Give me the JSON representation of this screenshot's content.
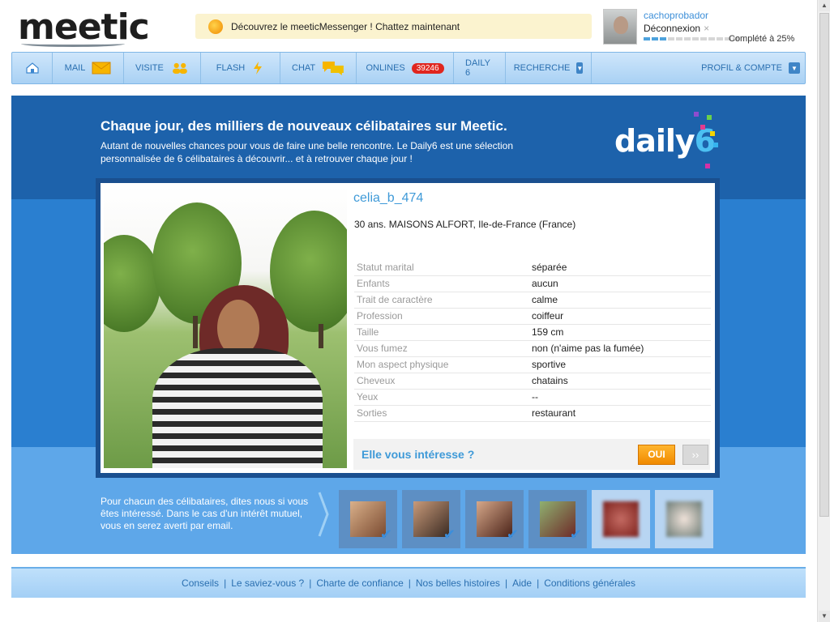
{
  "header": {
    "logo": "meetic",
    "promo_text": "Découvrez le meeticMessenger ! Chattez maintenant",
    "user": {
      "name": "cachoprobador",
      "logout": "Déconnexion",
      "completion": "Complété à 25%",
      "completion_value": 0.25
    }
  },
  "nav": {
    "items": [
      {
        "label": "",
        "icon": "home-icon"
      },
      {
        "label": "MAIL",
        "icon": "envelope-icon"
      },
      {
        "label": "VISITE",
        "icon": "people-icon"
      },
      {
        "label": "FLASH",
        "icon": "lightning-icon"
      },
      {
        "label": "CHAT",
        "icon": "chat-bubbles-icon"
      },
      {
        "label": "ONLINES",
        "badge": "39246"
      },
      {
        "label": "DAILY 6"
      },
      {
        "label": "RECHERCHE",
        "icon": "dropdown-arrow-icon"
      }
    ],
    "right": {
      "label": "PROFIL & COMPTE",
      "icon": "dropdown-arrow-icon"
    }
  },
  "hero": {
    "headline": "Chaque jour, des milliers de nouveaux célibataires sur Meetic.",
    "subline": "Autant de nouvelles chances pour vous de faire une belle rencontre. Le Daily6 est une sélection personnalisée de 6 célibataires à découvrir... et à retrouver chaque jour !",
    "daily_logo": "daily",
    "daily_logo_six": "6"
  },
  "profile": {
    "name": "celia_b_474",
    "info": "30 ans. MAISONS ALFORT, Ile-de-France (France)",
    "details": [
      {
        "key": "Statut marital",
        "value": "séparée"
      },
      {
        "key": "Enfants",
        "value": "aucun"
      },
      {
        "key": "Trait de caractère",
        "value": "calme"
      },
      {
        "key": "Profession",
        "value": "coiffeur"
      },
      {
        "key": "Taille",
        "value": "159 cm"
      },
      {
        "key": "Vous fumez",
        "value": "non (n'aime pas la fumée)"
      },
      {
        "key": "Mon aspect physique",
        "value": "sportive"
      },
      {
        "key": "Cheveux",
        "value": "chatains"
      },
      {
        "key": "Yeux",
        "value": "--"
      },
      {
        "key": "Sorties",
        "value": "restaurant"
      }
    ],
    "interest_question": "Elle vous intéresse ?",
    "yes_button": "OUI",
    "next_button": "››"
  },
  "bottom": {
    "note": "Pour chacun des célibataires, dites nous si vous êtes intéressé. Dans le cas d'un intérêt mutuel, vous en serez averti par email."
  },
  "footer": {
    "links": [
      "Conseils",
      "Le saviez-vous ?",
      "Charte de confiance",
      "Nos belles histoires",
      "Aide",
      "Conditions générales"
    ]
  },
  "colors": {
    "brand_blue": "#1d62ab",
    "accent_pink": "#e8307f",
    "button_orange": "#f08a00",
    "link_blue": "#3f9ad8"
  }
}
